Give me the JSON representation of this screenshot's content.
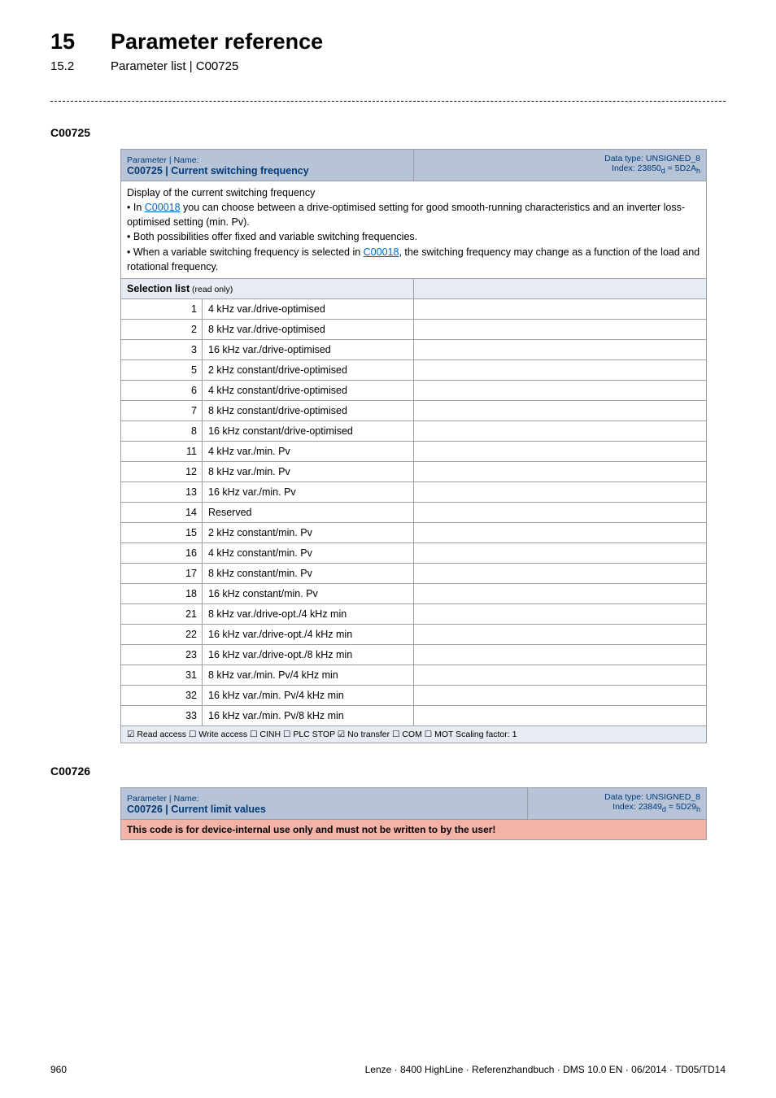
{
  "header": {
    "chapter_num": "15",
    "chapter_title": "Parameter reference",
    "section_num": "15.2",
    "section_title": "Parameter list | C00725"
  },
  "block1": {
    "code_label": "C00725",
    "param_name_label": "Parameter | Name:",
    "param_title": "C00725 | Current switching frequency",
    "data_type": "Data type: UNSIGNED_8",
    "index": "Index: 23850",
    "index_d": "d",
    "index_suffix": " = 5D2A",
    "index_h": "h",
    "desc_title": "Display of the current switching frequency",
    "desc_bullet1_pre": "In ",
    "desc_bullet1_link": "C00018",
    "desc_bullet1_post": " you can choose between a drive-optimised setting for good smooth-running characteristics and an inverter loss-optimised setting (min. Pv).",
    "desc_bullet2": "Both possibilities offer fixed and variable switching frequencies.",
    "desc_bullet3_pre": "When a variable switching frequency is selected in ",
    "desc_bullet3_link": "C00018",
    "desc_bullet3_post": ", the switching frequency may change as a function of the load and rotational frequency.",
    "sel_header_bold": "Selection list",
    "sel_header_small": " (read only)",
    "rows": [
      {
        "n": "1",
        "label": "4 kHz var./drive-optimised"
      },
      {
        "n": "2",
        "label": "8 kHz var./drive-optimised"
      },
      {
        "n": "3",
        "label": "16 kHz var./drive-optimised"
      },
      {
        "n": "5",
        "label": "2 kHz constant/drive-optimised"
      },
      {
        "n": "6",
        "label": "4 kHz constant/drive-optimised"
      },
      {
        "n": "7",
        "label": "8 kHz constant/drive-optimised"
      },
      {
        "n": "8",
        "label": "16 kHz constant/drive-optimised"
      },
      {
        "n": "11",
        "label": "4 kHz var./min. Pv"
      },
      {
        "n": "12",
        "label": "8 kHz var./min. Pv"
      },
      {
        "n": "13",
        "label": "16 kHz var./min. Pv"
      },
      {
        "n": "14",
        "label": "Reserved"
      },
      {
        "n": "15",
        "label": "2 kHz constant/min. Pv"
      },
      {
        "n": "16",
        "label": "4 kHz constant/min. Pv"
      },
      {
        "n": "17",
        "label": "8 kHz constant/min. Pv"
      },
      {
        "n": "18",
        "label": "16 kHz constant/min. Pv"
      },
      {
        "n": "21",
        "label": "8 kHz var./drive-opt./4 kHz min"
      },
      {
        "n": "22",
        "label": "16 kHz var./drive-opt./4 kHz min"
      },
      {
        "n": "23",
        "label": "16 kHz var./drive-opt./8 kHz min"
      },
      {
        "n": "31",
        "label": "8 kHz var./min. Pv/4 kHz min"
      },
      {
        "n": "32",
        "label": "16 kHz var./min. Pv/4 kHz min"
      },
      {
        "n": "33",
        "label": "16 kHz var./min. Pv/8 kHz min"
      }
    ],
    "footer": "☑ Read access   ☐ Write access   ☐ CINH   ☐ PLC STOP   ☑ No transfer   ☐ COM   ☐ MOT      Scaling factor: 1"
  },
  "block2": {
    "code_label": "C00726",
    "param_name_label": "Parameter | Name:",
    "param_title": "C00726 | Current limit values",
    "data_type": "Data type: UNSIGNED_8",
    "index": "Index: 23849",
    "index_d": "d",
    "index_suffix": " = 5D29",
    "index_h": "h",
    "warn": "This code is for device-internal use only and must not be written to by the user!"
  },
  "footer": {
    "page": "960",
    "imprint": "Lenze · 8400 HighLine · Referenzhandbuch · DMS 10.0 EN · 06/2014 · TD05/TD14"
  }
}
